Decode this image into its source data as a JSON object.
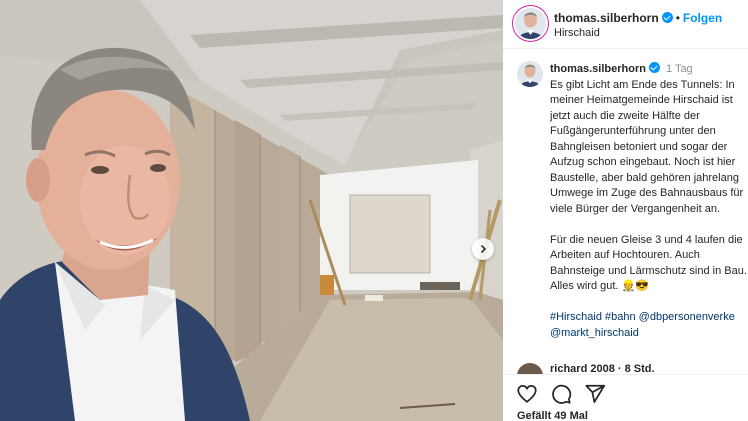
{
  "post": {
    "username": "thomas.silberhorn",
    "follow_label": "Folgen",
    "location": "Hirschaid",
    "time_ago": "1 Tag",
    "caption_lines": [
      "Es gibt Licht am Ende des Tunnels: In",
      "meiner Heimatgemeinde Hirschaid ist",
      "jetzt auch die zweite Hälfte der",
      "Fußgängerunterführung unter den",
      "Bahngleisen betoniert und sogar der",
      "Aufzug schon eingebaut. Noch ist hier",
      "Baustelle, aber bald gehören jahrelang",
      "Umwege im Zuge des Bahnausbaus für",
      "viele Bürger der Vergangenheit an.",
      "",
      "Für die neuen Gleise 3 und 4 laufen die",
      "Arbeiten auf Hochtouren. Auch",
      "Bahnsteige und Lärmschutz sind in Bau.",
      "Alles wird gut. 👷😎"
    ],
    "hashtag_lines": [
      "#Hirschaid #bahn @dbpersonenverke",
      "@markt_hirschaid"
    ],
    "partial_comment": "richard 2008 · 8 Std.",
    "likes": "Gefällt 49 Mal"
  },
  "icons": {
    "like": "heart-icon",
    "comment": "comment-icon",
    "share": "share-icon",
    "verified": "verified-badge-icon",
    "next": "chevron-right-icon"
  },
  "colors": {
    "accent": "#0095f6",
    "hashtag": "#00376b",
    "muted": "#8e8e8e"
  }
}
